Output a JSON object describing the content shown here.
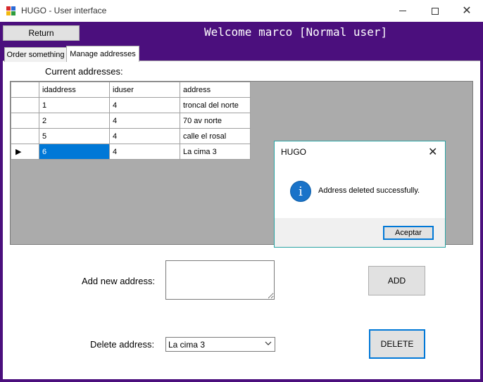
{
  "window": {
    "title": "HUGO - User interface",
    "minimize_glyph": "",
    "close_glyph": "✕"
  },
  "header": {
    "return_label": "Return",
    "welcome": "Welcome marco [Normal user]",
    "background": "#4b0f7d"
  },
  "tabs": [
    {
      "label": "Order something",
      "selected": false
    },
    {
      "label": "Manage addresses",
      "selected": true
    }
  ],
  "addresses": {
    "label": "Current addresses:",
    "columns": [
      "idaddress",
      "iduser",
      "address"
    ],
    "rows": [
      {
        "idaddress": "1",
        "iduser": "4",
        "address": "troncal del norte",
        "current": false
      },
      {
        "idaddress": "2",
        "iduser": "4",
        "address": "70 av norte",
        "current": false
      },
      {
        "idaddress": "5",
        "iduser": "4",
        "address": "calle el rosal",
        "current": false
      },
      {
        "idaddress": "6",
        "iduser": "4",
        "address": "La cima 3",
        "current": true
      }
    ],
    "current_row_marker": "▶"
  },
  "add_address": {
    "label": "Add new address:",
    "value": "",
    "button": "ADD"
  },
  "delete_address": {
    "label": "Delete address:",
    "selected": "La cima 3",
    "button": "DELETE"
  },
  "message_box": {
    "title": "HUGO",
    "message": "Address deleted successfully.",
    "icon": "info-icon",
    "icon_glyph": "i",
    "ok_label": "Aceptar",
    "close_glyph": "✕"
  },
  "colors": {
    "accent": "#0078d7",
    "grid_background": "#ababab",
    "frame": "#4b0f7d"
  }
}
